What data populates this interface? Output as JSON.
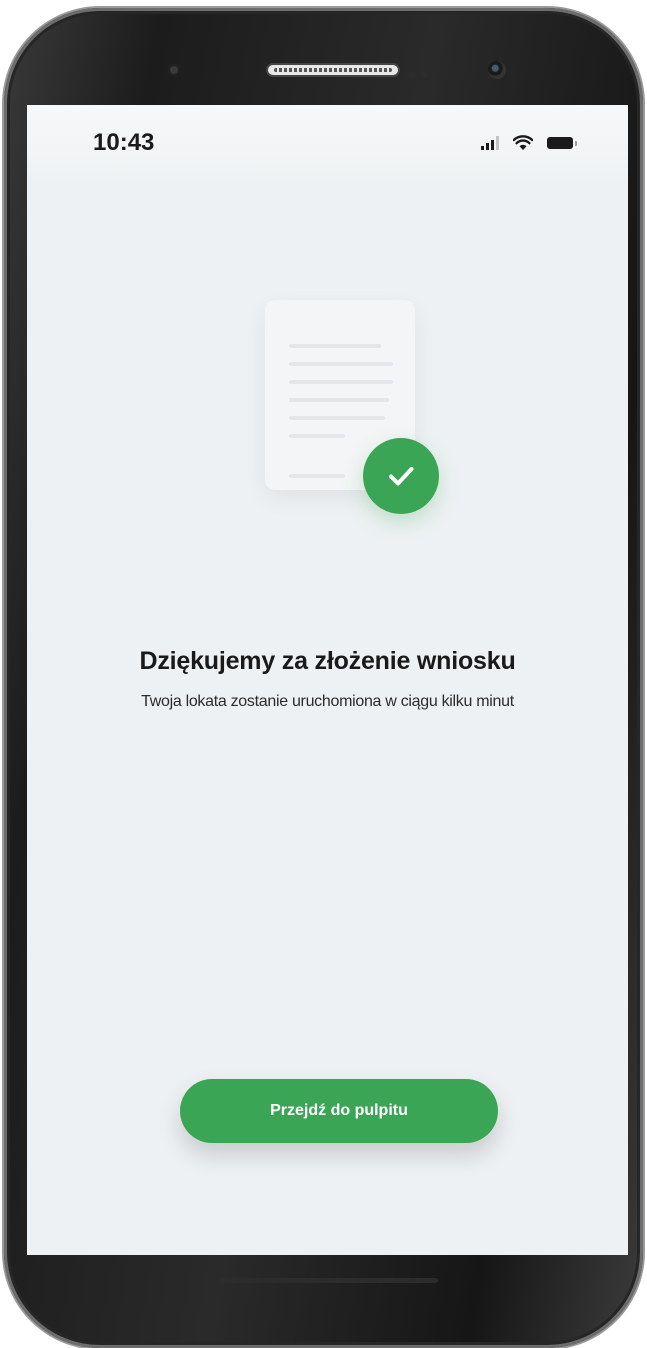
{
  "status_bar": {
    "time": "10:43"
  },
  "icons": {
    "signal": "signal-icon",
    "wifi": "wifi-icon",
    "battery": "battery-icon",
    "document": "document-icon",
    "check": "check-icon"
  },
  "confirmation": {
    "title": "Dziękujemy za złożenie wniosku",
    "message": "Twoja lokata zostanie uruchomiona w ciągu kilku minut"
  },
  "actions": {
    "dashboard_button_label": "Przejdź do pulpitu"
  },
  "colors": {
    "accent": "#3aa655",
    "background": "#eef1f3",
    "text": "#1a1a1a"
  }
}
